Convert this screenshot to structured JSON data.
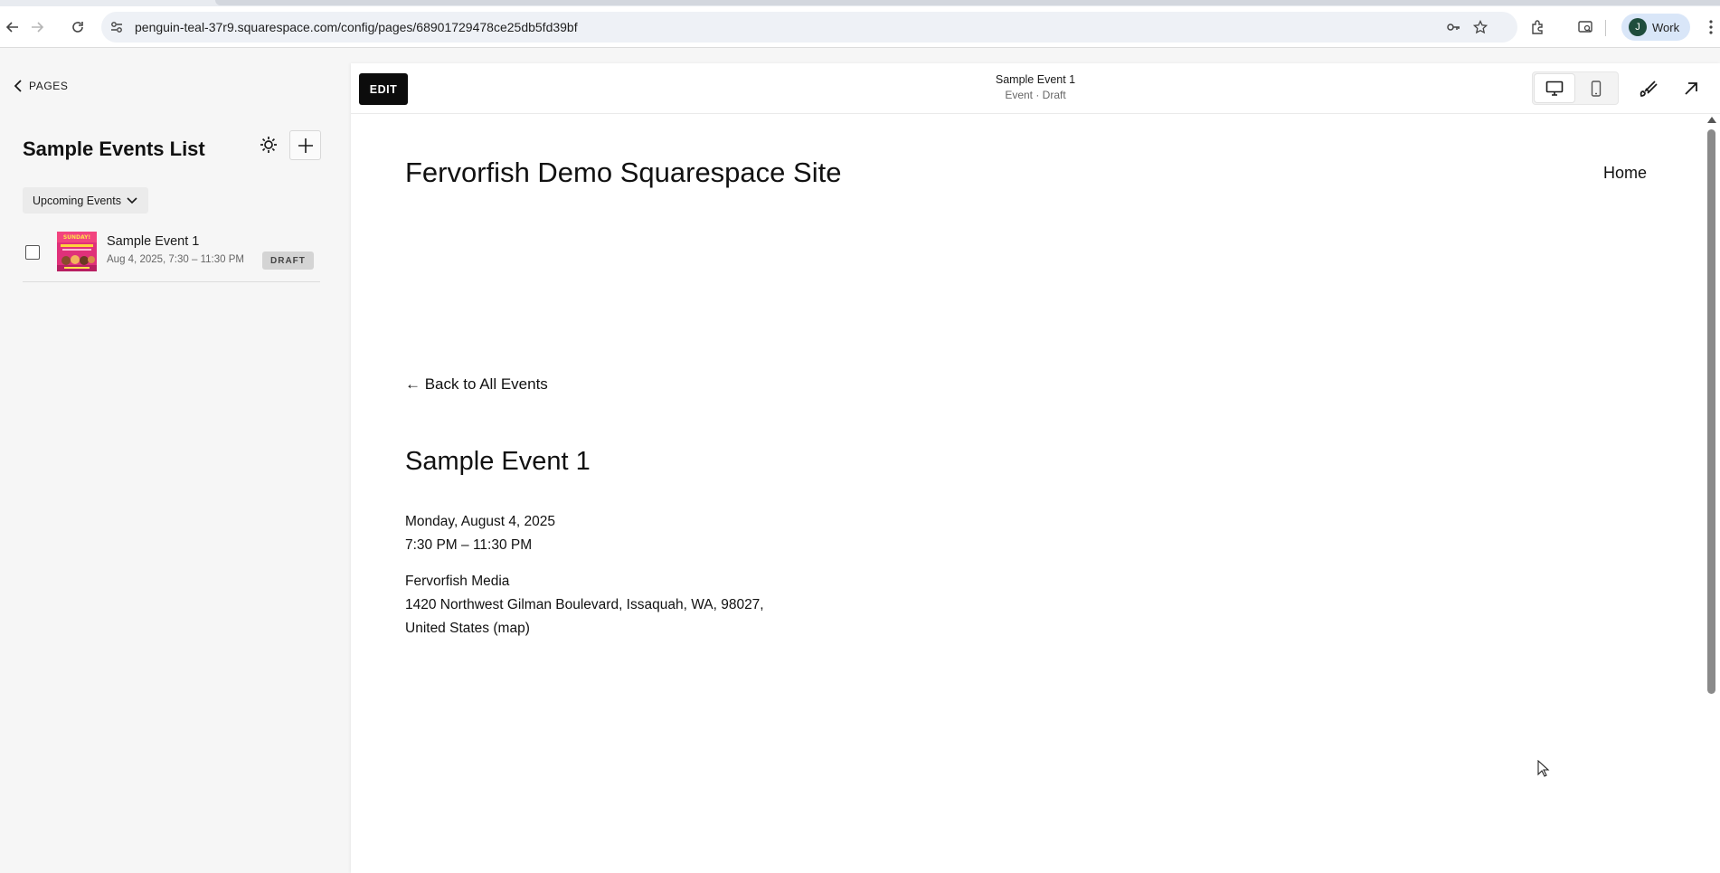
{
  "browser": {
    "url": "penguin-teal-37r9.squarespace.com/config/pages/68901729478ce25db5fd39bf",
    "profile_initial": "J",
    "profile_label": "Work"
  },
  "left_panel": {
    "back_label": "PAGES",
    "title": "Sample Events List",
    "filter_label": "Upcoming Events",
    "events": [
      {
        "name": "Sample Event 1",
        "meta": "Aug 4, 2025, 7:30 – 11:30 PM",
        "badge": "DRAFT",
        "thumb_text": "SUNDAY!"
      }
    ]
  },
  "editor": {
    "edit_label": "EDIT",
    "doc_title": "Sample Event 1",
    "doc_subtitle": "Event · Draft"
  },
  "site": {
    "title": "Fervorfish Demo Squarespace Site",
    "nav_home": "Home",
    "back_link": "← Back to All Events",
    "event_title": "Sample Event 1",
    "event_date": "Monday, August 4, 2025",
    "event_time": "7:30 PM – 11:30 PM",
    "venue_name": "Fervorfish Media",
    "venue_address_line1": "1420 Northwest Gilman Boulevard, Issaquah, WA, 98027,",
    "venue_address_line2": "United States",
    "map_link": "(map)"
  },
  "colors": {
    "accent_dark": "#0c0c0c",
    "panel_bg": "#f6f6f6",
    "badge_bg": "#d4d4d4",
    "profile_bg": "#d9e6f8"
  },
  "icons": {
    "back": "arrow-left-icon",
    "forward": "arrow-right-icon",
    "reload": "reload-icon",
    "gear": "gear-icon",
    "add": "plus-icon",
    "desktop": "desktop-icon",
    "mobile": "mobile-icon",
    "style": "paintbrush-icon",
    "expand": "arrow-up-right-icon"
  }
}
